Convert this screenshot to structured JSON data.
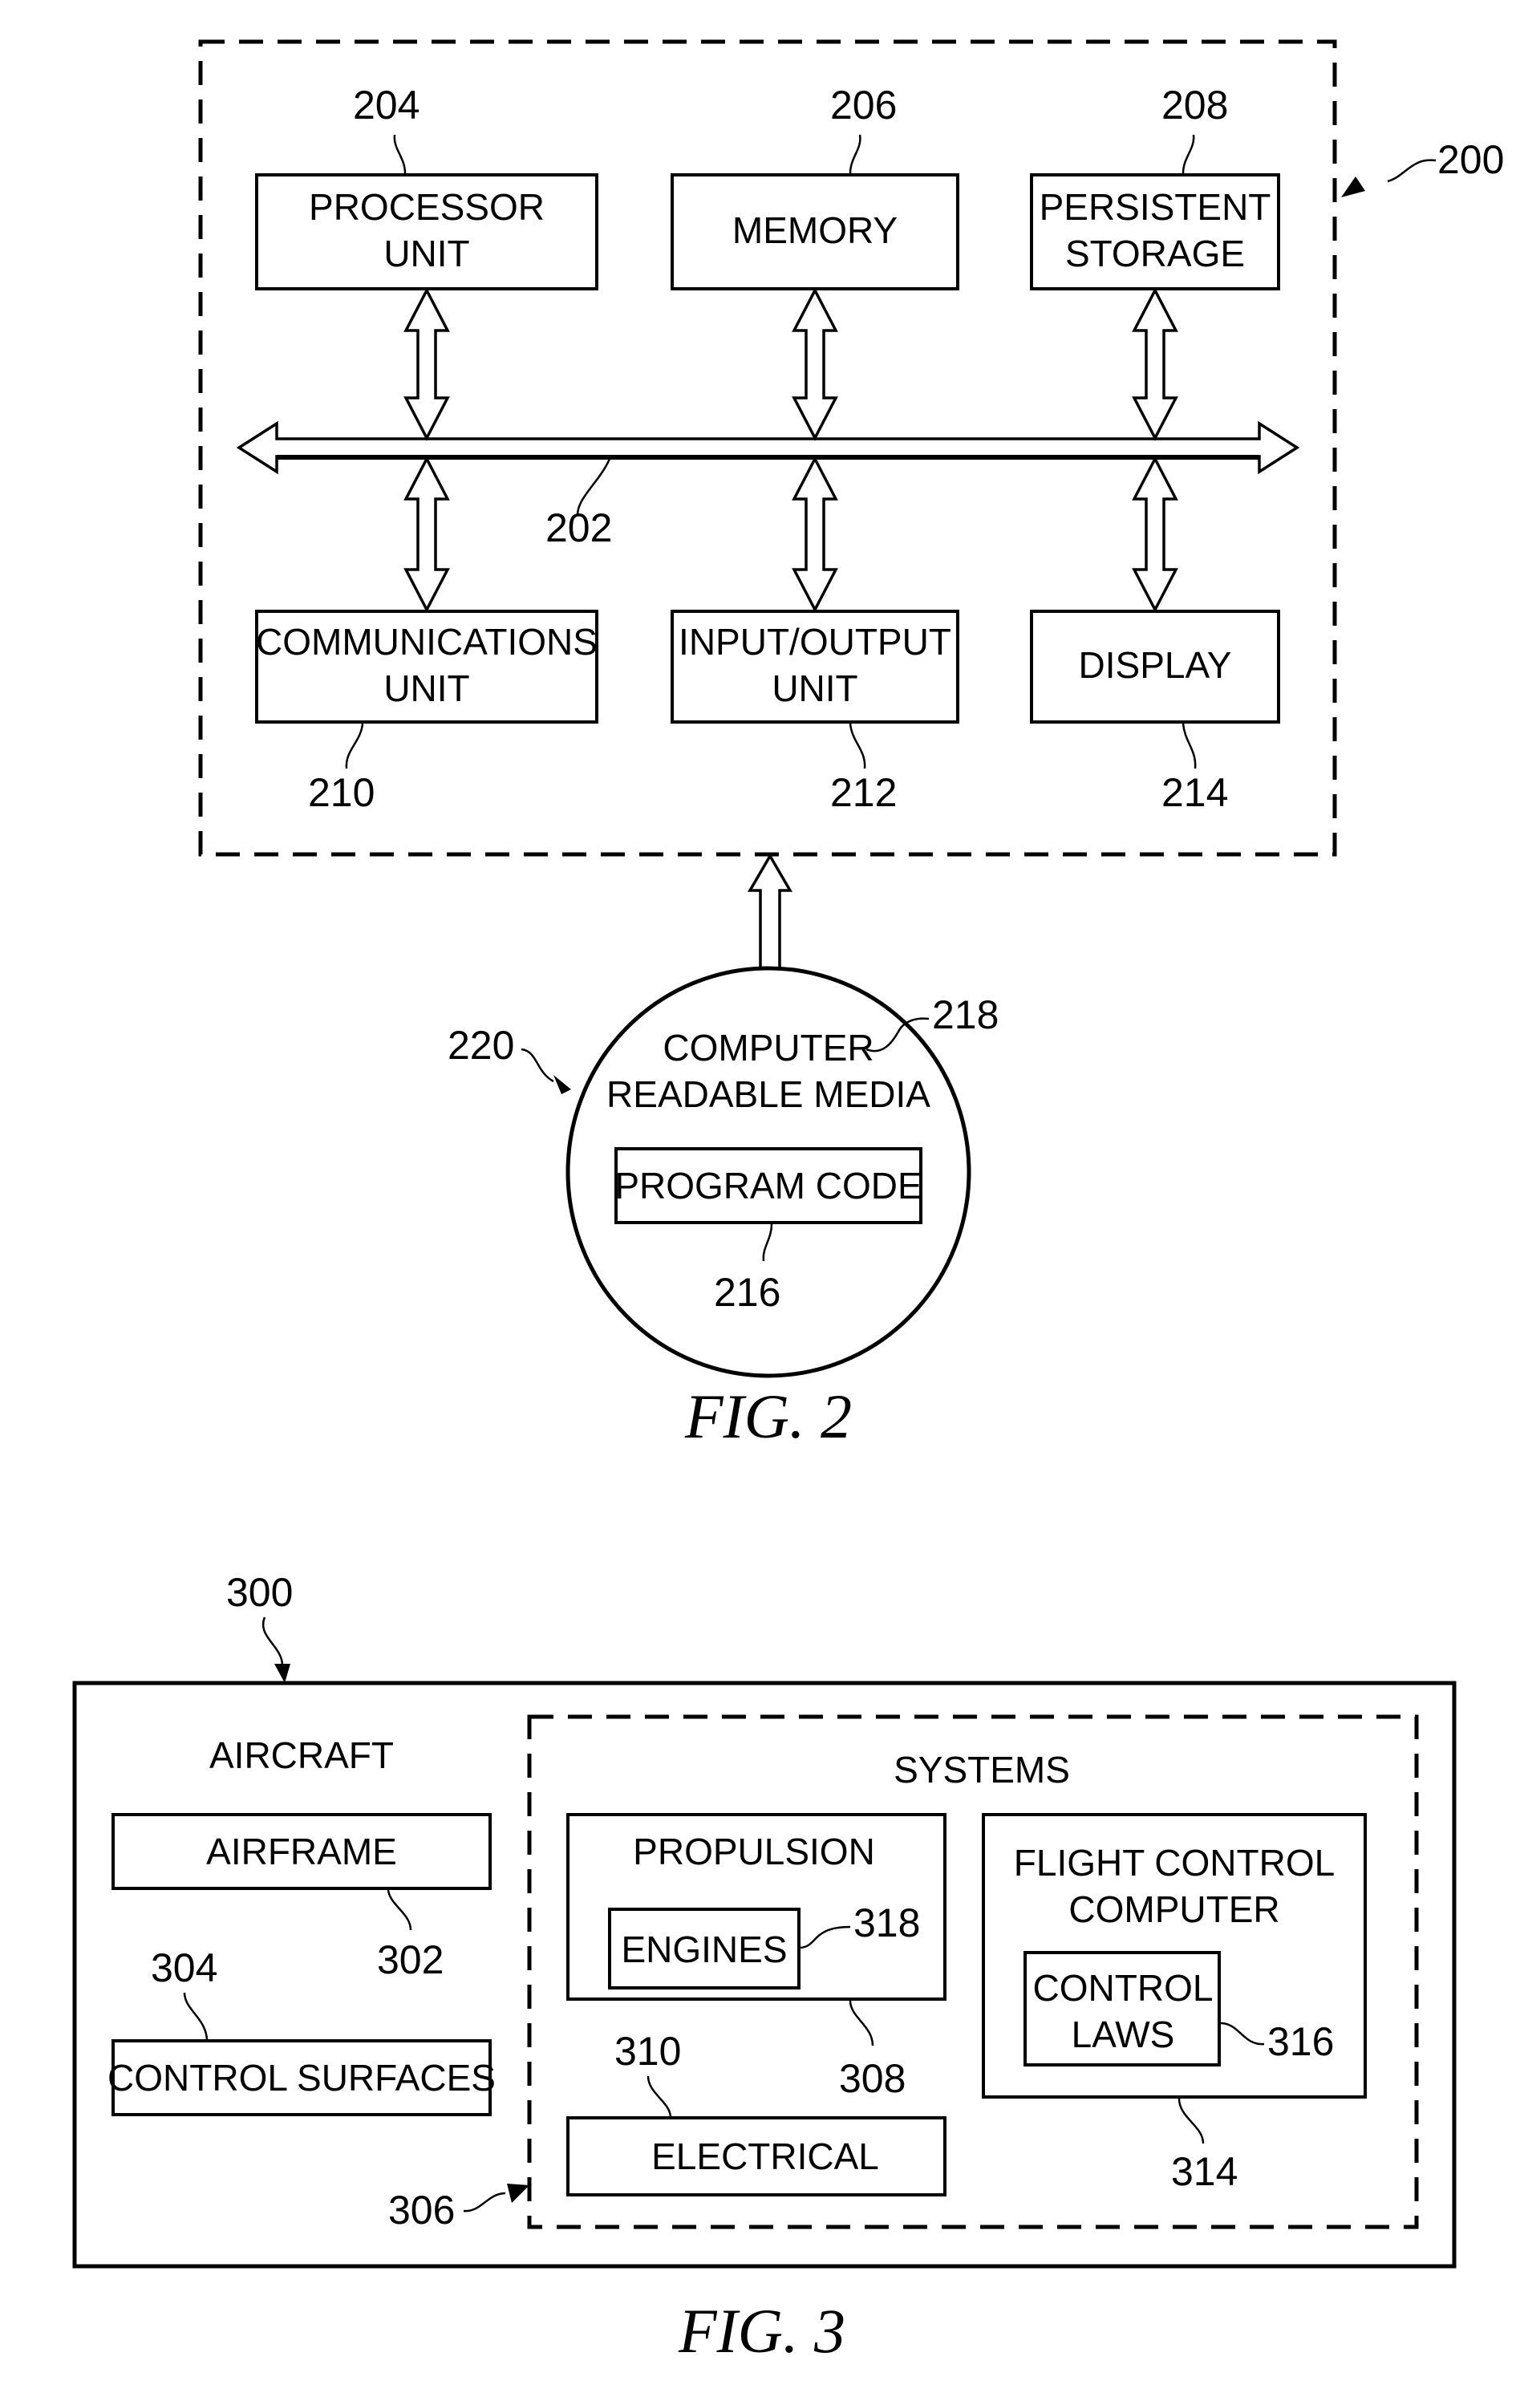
{
  "fig2": {
    "caption": "FIG. 2",
    "system_ref": "200",
    "bus_ref": "202",
    "boxes": [
      {
        "ref": "204",
        "line1": "PROCESSOR",
        "line2": "UNIT"
      },
      {
        "ref": "206",
        "line1": "MEMORY",
        "line2": ""
      },
      {
        "ref": "208",
        "line1": "PERSISTENT",
        "line2": "STORAGE"
      },
      {
        "ref": "210",
        "line1": "COMMUNICATIONS",
        "line2": "UNIT"
      },
      {
        "ref": "212",
        "line1": "INPUT/OUTPUT",
        "line2": "UNIT"
      },
      {
        "ref": "214",
        "line1": "DISPLAY",
        "line2": ""
      }
    ],
    "media": {
      "ref": "220",
      "media_ref": "218",
      "line1": "COMPUTER",
      "line2": "READABLE MEDIA",
      "code_label": "PROGRAM CODE",
      "code_ref": "216"
    }
  },
  "fig3": {
    "caption": "FIG. 3",
    "aircraft_ref": "300",
    "aircraft_label": "AIRCRAFT",
    "airframe": {
      "label": "AIRFRAME",
      "ref": "302"
    },
    "control_surfaces": {
      "label": "CONTROL SURFACES",
      "ref": "304"
    },
    "systems": {
      "label": "SYSTEMS",
      "ref": "306"
    },
    "propulsion": {
      "label": "PROPULSION",
      "ref": "308"
    },
    "engines": {
      "label": "ENGINES",
      "ref": "318"
    },
    "electrical": {
      "label": "ELECTRICAL",
      "ref": "310"
    },
    "flight_control": {
      "line1": "FLIGHT CONTROL",
      "line2": "COMPUTER",
      "ref": "314"
    },
    "control_laws": {
      "line1": "CONTROL",
      "line2": "LAWS",
      "ref": "316"
    }
  }
}
